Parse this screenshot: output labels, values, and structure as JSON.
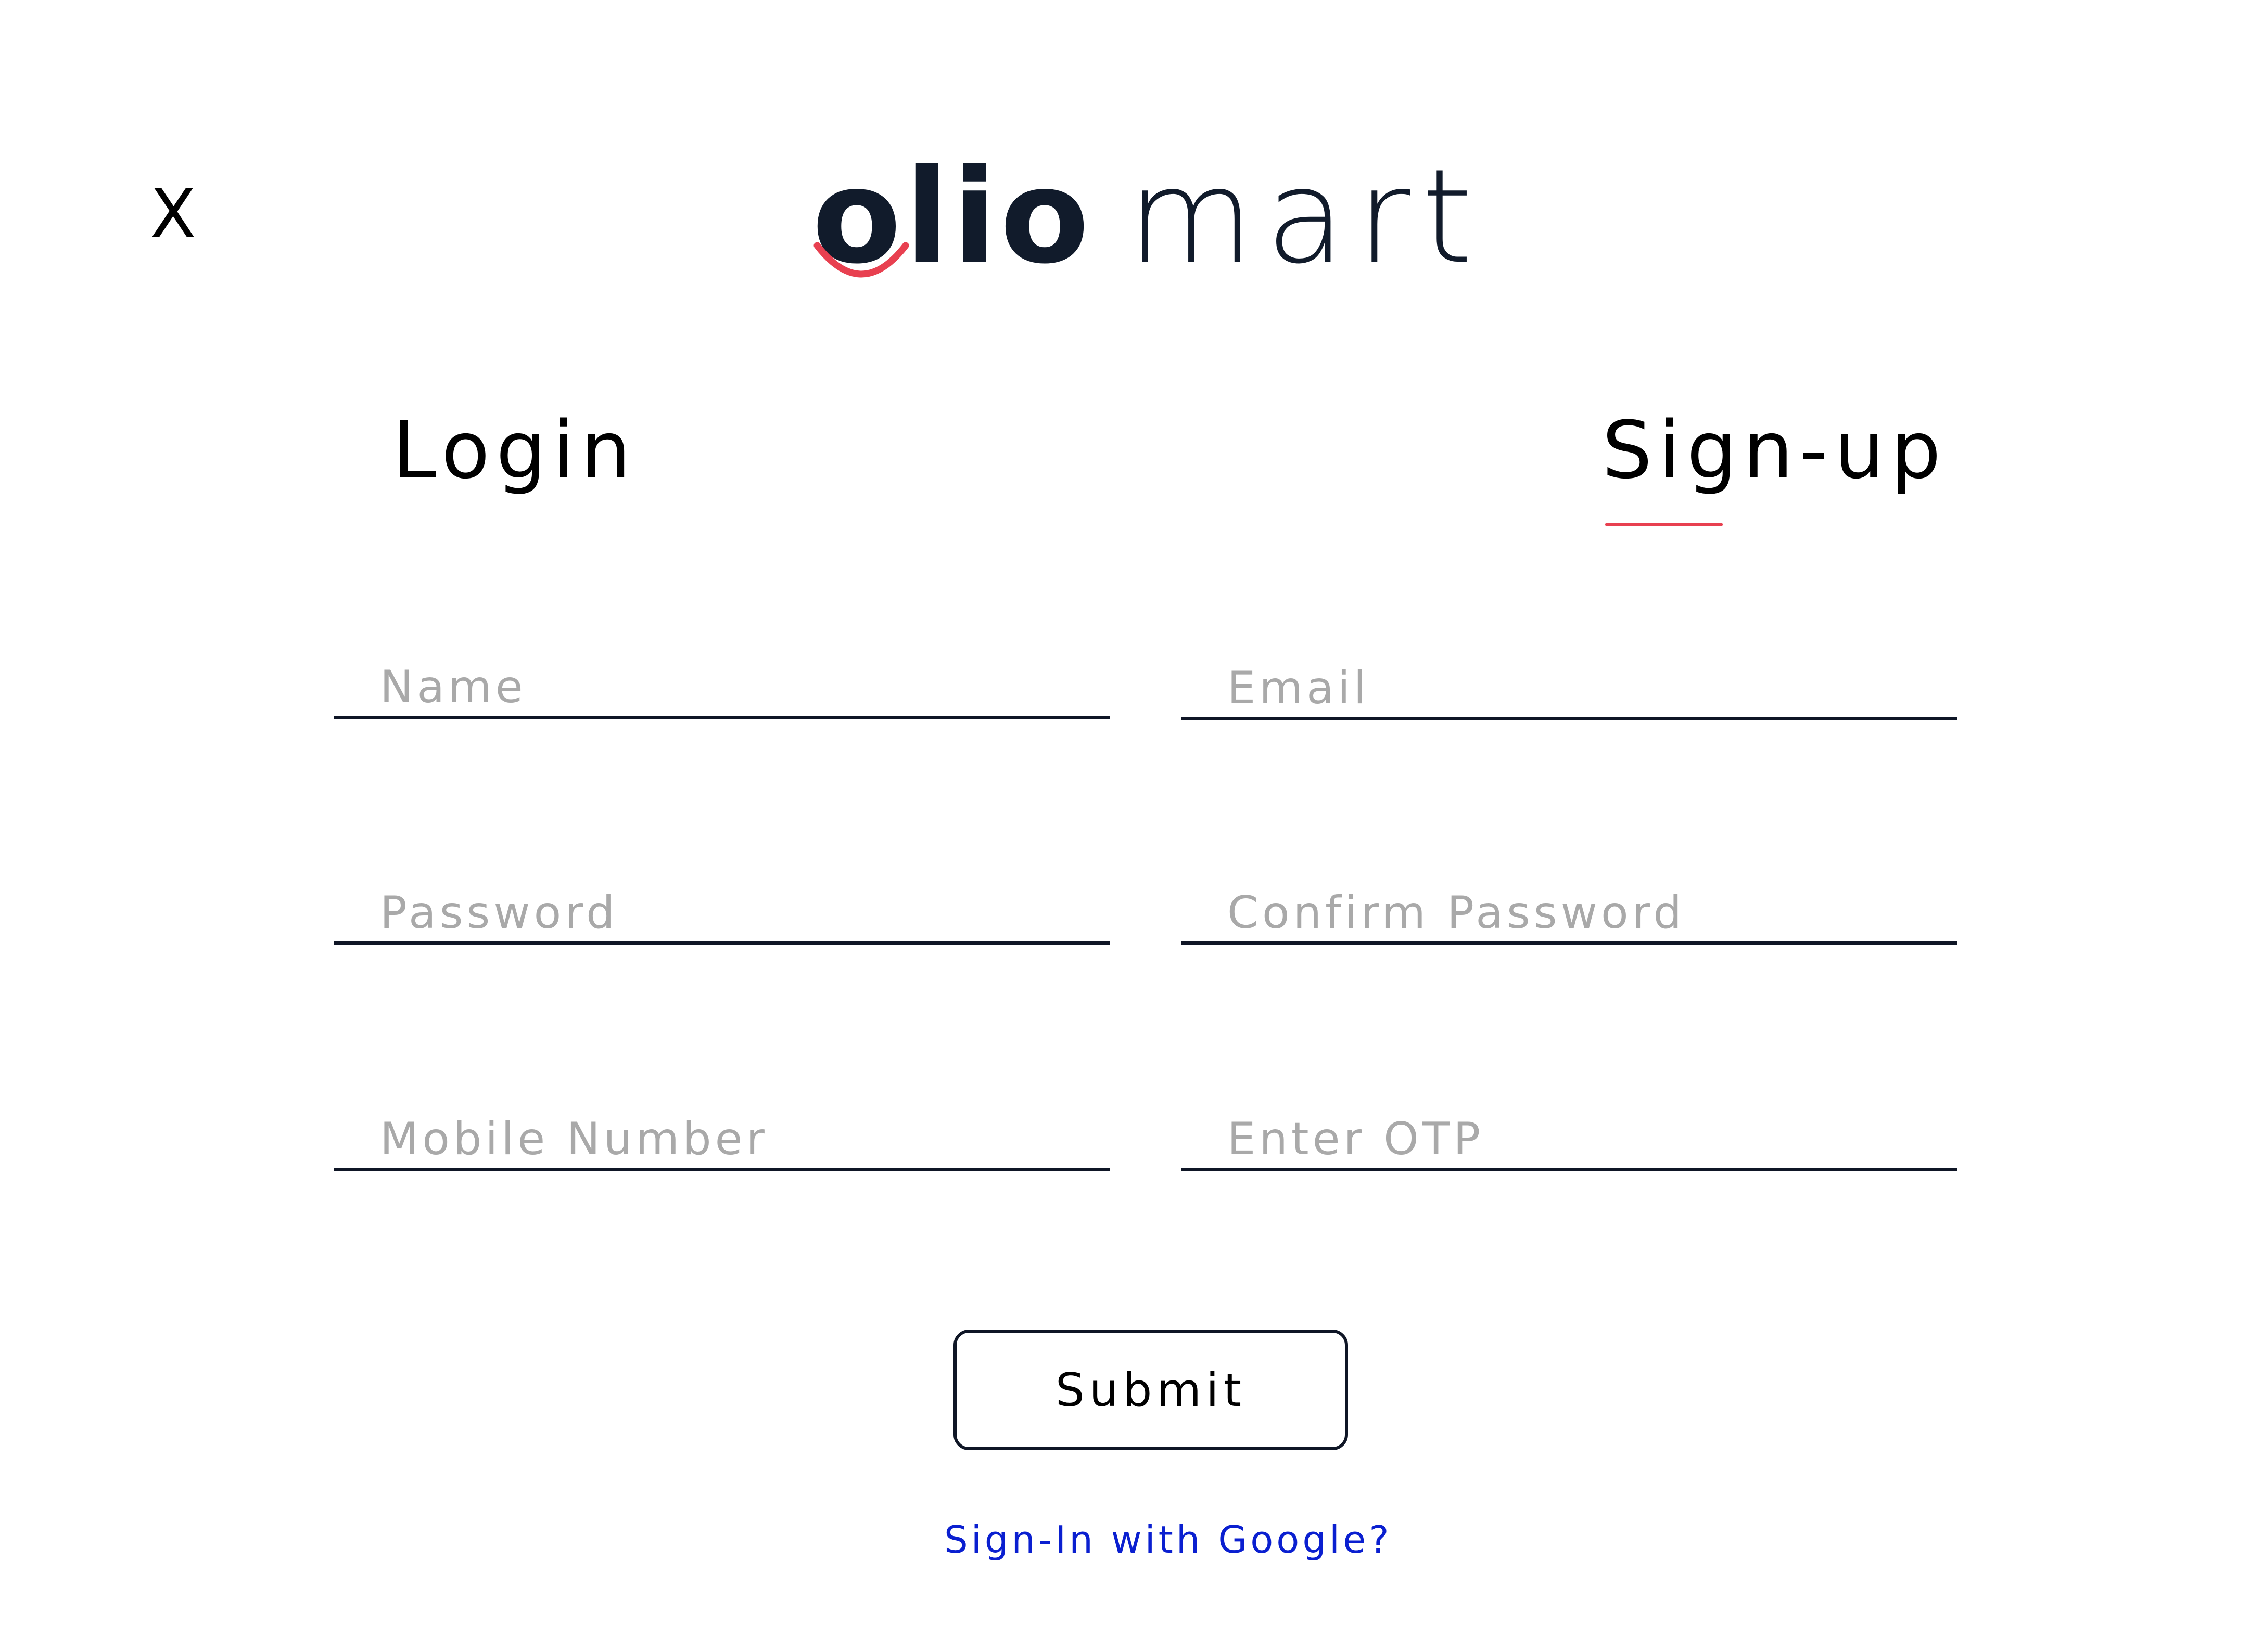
{
  "colors": {
    "accent": "#e84050",
    "ink": "#111b2b",
    "link": "#0a1fd0",
    "placeholder": "#a9a9a9"
  },
  "close": {
    "label": "X",
    "icon": "close-icon"
  },
  "logo": {
    "bold_text": "olio",
    "light_text": "mart"
  },
  "tabs": {
    "login": "Login",
    "signup": "Sign-up",
    "active": "signup"
  },
  "form": {
    "name": {
      "placeholder": "Name",
      "value": ""
    },
    "email": {
      "placeholder": "Email",
      "value": ""
    },
    "password": {
      "placeholder": "Password",
      "value": ""
    },
    "confirm_password": {
      "placeholder": "Confirm Password",
      "value": ""
    },
    "mobile": {
      "placeholder": "Mobile Number",
      "value": ""
    },
    "otp": {
      "placeholder": "Enter OTP",
      "value": ""
    }
  },
  "submit_label": "Submit",
  "google_link": "Sign-In with Google?"
}
